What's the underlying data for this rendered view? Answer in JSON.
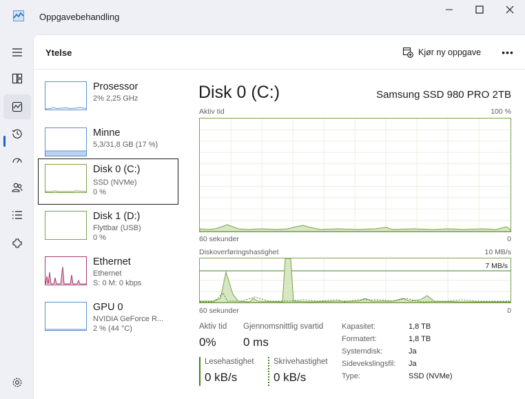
{
  "window": {
    "title": "Oppgavebehandling",
    "icons": [
      "app-icon",
      "minimize-icon",
      "maximize-icon",
      "close-icon"
    ]
  },
  "nav": {
    "items": [
      "menu-icon",
      "processes-icon",
      "performance-icon",
      "app-history-icon",
      "startup-apps-icon",
      "users-icon",
      "details-icon",
      "services-icon",
      "settings-icon"
    ],
    "active": "performance-icon"
  },
  "header": {
    "title": "Ytelse",
    "run_task_label": "Kjør ny oppgave",
    "more_label": "•••"
  },
  "devices": [
    {
      "name": "Prosessor",
      "line1": "2% 2,25 GHz",
      "line2": ""
    },
    {
      "name": "Minne",
      "line1": "5,3/31,8 GB (17 %)",
      "line2": ""
    },
    {
      "name": "Disk 0 (C:)",
      "line1": "SSD (NVMe)",
      "line2": "0 %"
    },
    {
      "name": "Disk 1 (D:)",
      "line1": "Flyttbar (USB)",
      "line2": "0 %"
    },
    {
      "name": "Ethernet",
      "line1": "Ethernet",
      "line2": "S: 0 M: 0 kbps"
    },
    {
      "name": "GPU 0",
      "line1": "NVIDIA GeForce R...",
      "line2": "2 % (44 °C)"
    }
  ],
  "detail": {
    "title": "Disk 0 (C:)",
    "model": "Samsung SSD 980 PRO 2TB",
    "graph1": {
      "label": "Aktiv tid",
      "max": "100 %",
      "time": "60 sekunder",
      "min": "0"
    },
    "graph2": {
      "label": "Diskoverføringshastighet",
      "max": "10 MB/s",
      "marker": "7 MB/s",
      "time": "60 sekunder",
      "min": "0"
    },
    "active_time": {
      "label": "Aktiv tid",
      "value": "0%"
    },
    "response": {
      "label": "Gjennomsnittlig svartid",
      "value": "0 ms"
    },
    "read": {
      "label": "Lesehastighet",
      "value": "0 kB/s"
    },
    "write": {
      "label": "Skrivehastighet",
      "value": "0 kB/s"
    },
    "properties": [
      {
        "key": "Kapasitet:",
        "value": "1,8 TB"
      },
      {
        "key": "Formatert:",
        "value": "1,8 TB"
      },
      {
        "key": "Systemdisk:",
        "value": "Ja"
      },
      {
        "key": "Sidevekslingsfil:",
        "value": "Ja"
      },
      {
        "key": "Type:",
        "value": "SSD (NVMe)"
      }
    ]
  },
  "colors": {
    "accent": "#1a62c5",
    "disk_green": "#7aa14a",
    "network_pink": "#a53a6c",
    "cpu_blue": "#5c8fcf"
  }
}
